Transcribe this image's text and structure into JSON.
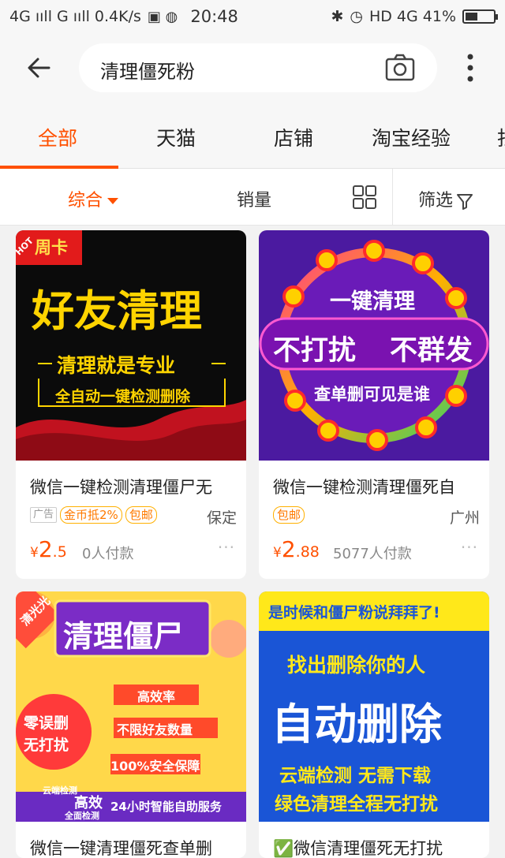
{
  "status_bar": {
    "left": "4G ııll G ııll 0.4K/s",
    "time": "20:48",
    "right": "HD 4G 41%",
    "battery_level": 0.41
  },
  "search": {
    "query": "清理僵死粉"
  },
  "tabs": [
    {
      "label": "全部"
    },
    {
      "label": "天猫"
    },
    {
      "label": "店铺"
    },
    {
      "label": "淘宝经验"
    },
    {
      "label": "找"
    }
  ],
  "sort": {
    "comprehensive": "综合",
    "sales": "销量",
    "filter": "筛选"
  },
  "products": [
    {
      "title": "微信一键检测清理僵尸无",
      "ad_tag": "广告",
      "tags": [
        "金币抵2%",
        "包邮"
      ],
      "location": "保定",
      "price_symbol": "¥",
      "price_int": "2",
      "price_dec": ".5",
      "sold": "0人付款",
      "poster": {
        "badge": "周卡",
        "hot": "HOT",
        "line1": "好友清理",
        "line2": "清理就是专业",
        "line3": "全自动一键检测删除"
      }
    },
    {
      "title": "微信一键检测清理僵死自",
      "tags": [
        "包邮"
      ],
      "location": "广州",
      "price_symbol": "¥",
      "price_int": "2",
      "price_dec": ".88",
      "sold": "5077人付款",
      "poster": {
        "line1": "一键清理",
        "line2": "不打扰",
        "line3": "不群发",
        "line4": "查单删可见是谁"
      }
    },
    {
      "title": "微信一键清理僵死查单删",
      "poster": {
        "corner": "清光光",
        "line1": "清理僵尸",
        "b1": "高效率",
        "b2": "不限好友数量",
        "b3": "100%安全保障",
        "left1": "零误删",
        "left2": "无打扰",
        "foot1": "云端检测",
        "foot2": "高效",
        "foot3": "全面检测",
        "foot4": "24小时智能自助服务"
      }
    },
    {
      "title": "✅微信清理僵死无打扰",
      "poster": {
        "top": "是时候和僵尸粉说拜拜了!",
        "line1": "找出删除你的人",
        "line2": "自动删除",
        "line3": "云端检测 无需下载",
        "line4": "绿色清理全程无打扰"
      }
    }
  ],
  "colors": {
    "accent": "#ff5000",
    "tag_border": "#ffb000"
  }
}
